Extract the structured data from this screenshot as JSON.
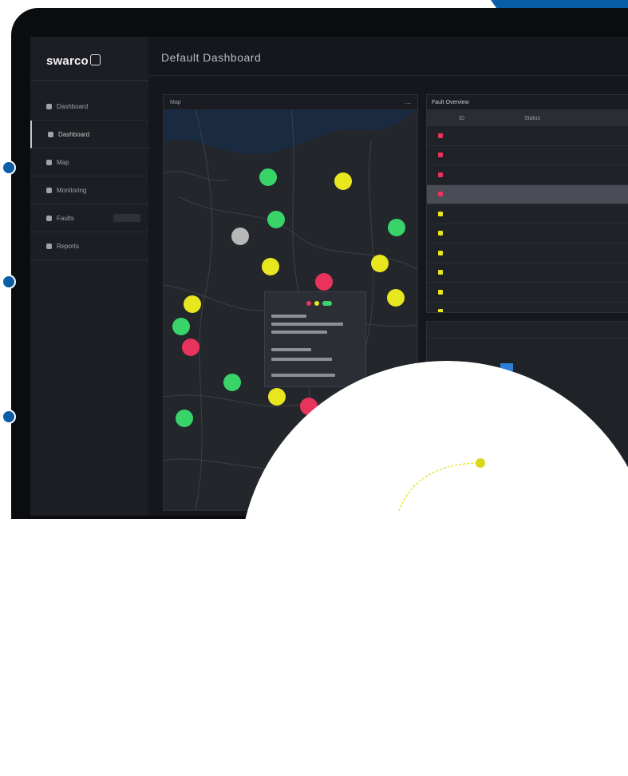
{
  "brand": {
    "logo_text": "swarco"
  },
  "header": {
    "title": "Default Dashboard"
  },
  "sidebar": {
    "items": [
      {
        "label": "Dashboard",
        "icon": "home-icon",
        "active": false
      },
      {
        "label": "Dashboard",
        "icon": "grid-icon",
        "active": true
      },
      {
        "label": "Map",
        "icon": "map-icon",
        "active": false
      },
      {
        "label": "Monitoring",
        "icon": "monitor-icon",
        "active": false
      },
      {
        "label": "Faults",
        "icon": "alert-icon",
        "active": false
      },
      {
        "label": "Reports",
        "icon": "report-icon",
        "active": false
      }
    ]
  },
  "map_panel": {
    "title": "Map",
    "menu": "..."
  },
  "fault_table": {
    "title": "Fault Overview",
    "columns": [
      "",
      "ID",
      "Status"
    ],
    "rows": [
      {
        "status_color": "#e8335d",
        "id": "",
        "status": "",
        "extra": "",
        "selected": false
      },
      {
        "status_color": "#e8335d",
        "id": "",
        "status": "",
        "extra": "",
        "selected": false
      },
      {
        "status_color": "#e8335d",
        "id": "",
        "status": "",
        "extra": "",
        "selected": false
      },
      {
        "status_color": "#e8335d",
        "id": "",
        "status": "",
        "extra": "",
        "selected": true
      },
      {
        "status_color": "#e8e61f",
        "id": "",
        "status": "",
        "extra": "",
        "selected": false
      },
      {
        "status_color": "#e8e61f",
        "id": "",
        "status": "",
        "extra": "",
        "selected": false
      },
      {
        "status_color": "#e8e61f",
        "id": "",
        "status": "",
        "extra": "",
        "selected": false
      },
      {
        "status_color": "#e8e61f",
        "id": "",
        "status": "",
        "extra": "",
        "selected": false
      },
      {
        "status_color": "#e8e61f",
        "id": "",
        "status": "",
        "extra": "",
        "selected": false
      },
      {
        "status_color": "#e8e61f",
        "id": "",
        "status": "",
        "extra": "",
        "selected": false
      }
    ]
  },
  "second_panel": {
    "title": ""
  },
  "colors": {
    "brand_blue": "#0a5ea8",
    "status_red": "#e8335d",
    "status_yellow": "#e8e61f",
    "status_green": "#38d46a",
    "status_grey": "#b8b8b8"
  }
}
